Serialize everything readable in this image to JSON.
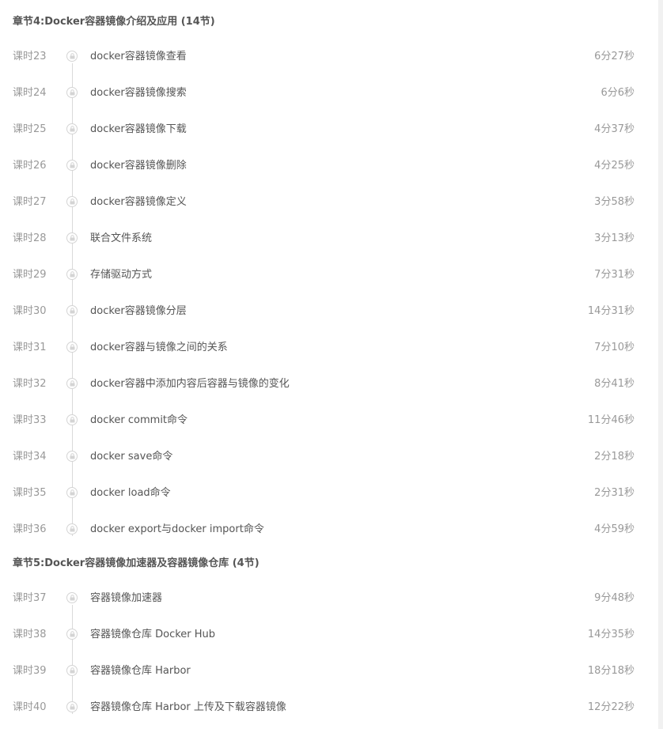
{
  "chapters": [
    {
      "title": "章节4:Docker容器镜像介绍及应用 (14节)",
      "lessons": [
        {
          "num": "课时23",
          "title": "docker容器镜像查看",
          "duration": "6分27秒"
        },
        {
          "num": "课时24",
          "title": "docker容器镜像搜索",
          "duration": "6分6秒"
        },
        {
          "num": "课时25",
          "title": "docker容器镜像下载",
          "duration": "4分37秒"
        },
        {
          "num": "课时26",
          "title": "docker容器镜像删除",
          "duration": "4分25秒"
        },
        {
          "num": "课时27",
          "title": "docker容器镜像定义",
          "duration": "3分58秒"
        },
        {
          "num": "课时28",
          "title": "联合文件系统",
          "duration": "3分13秒"
        },
        {
          "num": "课时29",
          "title": "存储驱动方式",
          "duration": "7分31秒"
        },
        {
          "num": "课时30",
          "title": "docker容器镜像分层",
          "duration": "14分31秒"
        },
        {
          "num": "课时31",
          "title": "docker容器与镜像之间的关系",
          "duration": "7分10秒"
        },
        {
          "num": "课时32",
          "title": "docker容器中添加内容后容器与镜像的变化",
          "duration": "8分41秒"
        },
        {
          "num": "课时33",
          "title": "docker commit命令",
          "duration": "11分46秒"
        },
        {
          "num": "课时34",
          "title": "docker save命令",
          "duration": "2分18秒"
        },
        {
          "num": "课时35",
          "title": "docker load命令",
          "duration": "2分31秒"
        },
        {
          "num": "课时36",
          "title": "docker export与docker import命令",
          "duration": "4分59秒"
        }
      ]
    },
    {
      "title": "章节5:Docker容器镜像加速器及容器镜像仓库 (4节)",
      "lessons": [
        {
          "num": "课时37",
          "title": "容器镜像加速器",
          "duration": "9分48秒"
        },
        {
          "num": "课时38",
          "title": "容器镜像仓库 Docker Hub",
          "duration": "14分35秒"
        },
        {
          "num": "课时39",
          "title": "容器镜像仓库 Harbor",
          "duration": "18分18秒"
        },
        {
          "num": "课时40",
          "title": "容器镜像仓库 Harbor 上传及下载容器镜像",
          "duration": "12分22秒"
        }
      ]
    }
  ],
  "icons": {
    "lesson_status": "lock-icon"
  },
  "colors": {
    "text_primary": "#555555",
    "text_secondary": "#999999",
    "timeline": "#d9d9d9"
  }
}
